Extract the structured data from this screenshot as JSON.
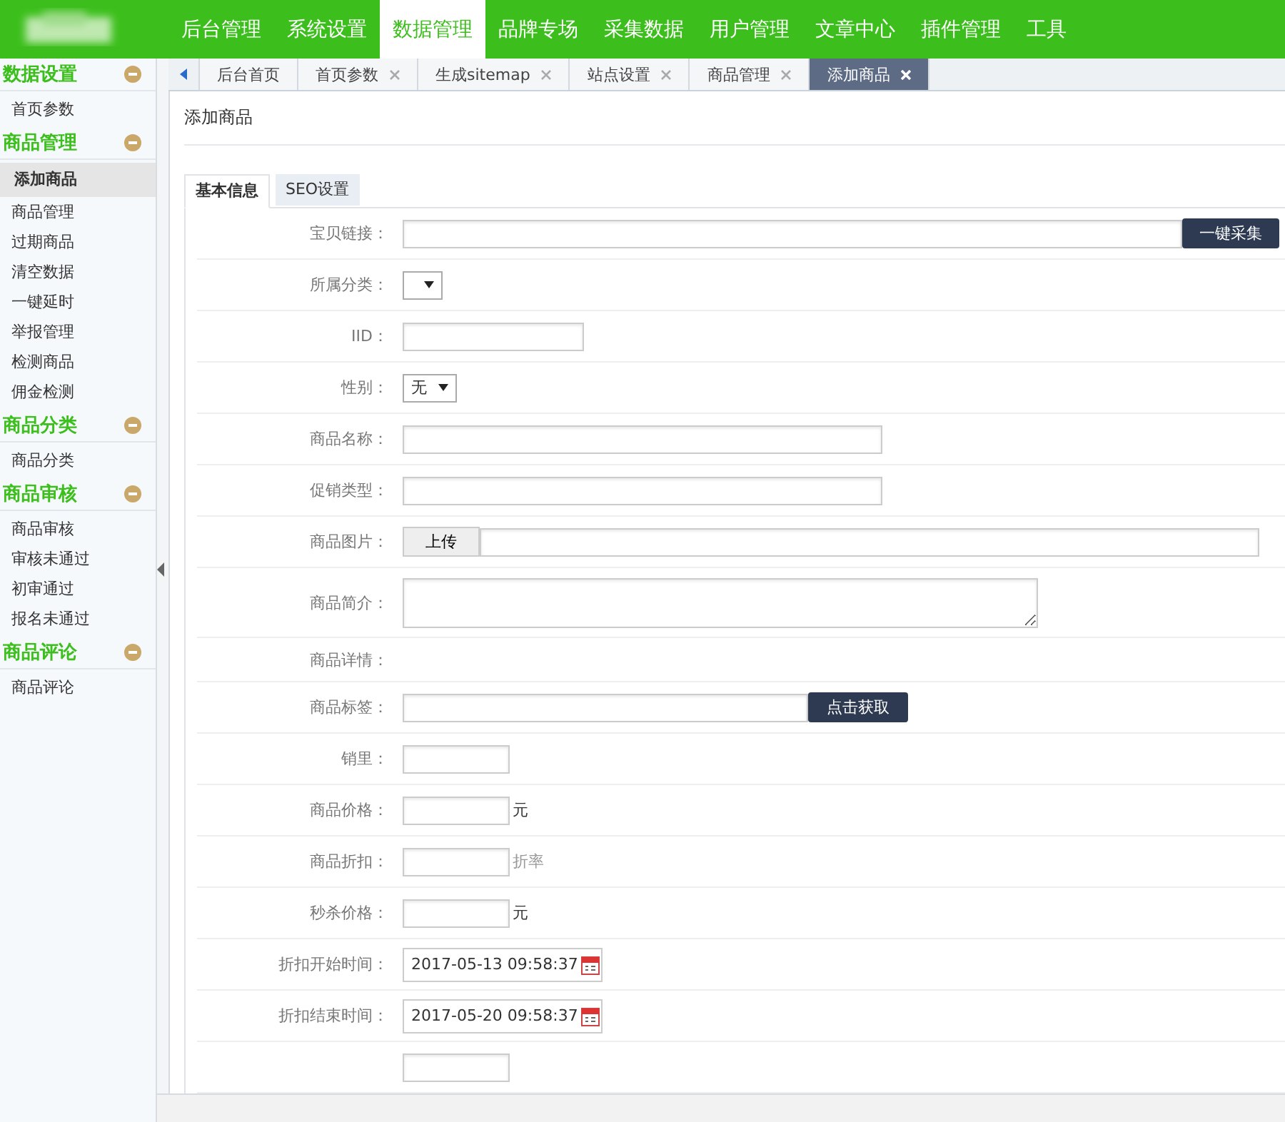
{
  "top_nav": [
    {
      "label": "后台管理",
      "selected": false
    },
    {
      "label": "系统设置",
      "selected": false
    },
    {
      "label": "数据管理",
      "selected": true
    },
    {
      "label": "品牌专场",
      "selected": false
    },
    {
      "label": "采集数据",
      "selected": false
    },
    {
      "label": "用户管理",
      "selected": false
    },
    {
      "label": "文章中心",
      "selected": false
    },
    {
      "label": "插件管理",
      "selected": false
    },
    {
      "label": "工具",
      "selected": false
    }
  ],
  "sidebar": {
    "groups": [
      {
        "title": "数据设置",
        "expanded": true,
        "items": [
          {
            "label": "首页参数",
            "selected": false
          }
        ]
      },
      {
        "title": "商品管理",
        "expanded": true,
        "items": [
          {
            "label": "添加商品",
            "selected": true
          },
          {
            "label": "商品管理",
            "selected": false
          },
          {
            "label": "过期商品",
            "selected": false
          },
          {
            "label": "清空数据",
            "selected": false
          },
          {
            "label": "一键延时",
            "selected": false
          },
          {
            "label": "举报管理",
            "selected": false
          },
          {
            "label": "检测商品",
            "selected": false
          },
          {
            "label": "佣金检测",
            "selected": false
          }
        ]
      },
      {
        "title": "商品分类",
        "expanded": true,
        "items": [
          {
            "label": "商品分类",
            "selected": false
          }
        ]
      },
      {
        "title": "商品审核",
        "expanded": true,
        "items": [
          {
            "label": "商品审核",
            "selected": false
          },
          {
            "label": "审核未通过",
            "selected": false
          },
          {
            "label": "初审通过",
            "selected": false
          },
          {
            "label": "报名未通过",
            "selected": false
          }
        ]
      },
      {
        "title": "商品评论",
        "expanded": true,
        "items": [
          {
            "label": "商品评论",
            "selected": false
          }
        ]
      }
    ]
  },
  "tabs": [
    {
      "label": "后台首页",
      "closable": false,
      "selected": false
    },
    {
      "label": "首页参数",
      "closable": true,
      "selected": false
    },
    {
      "label": "生成sitemap",
      "closable": true,
      "selected": false
    },
    {
      "label": "站点设置",
      "closable": true,
      "selected": false
    },
    {
      "label": "商品管理",
      "closable": true,
      "selected": false
    },
    {
      "label": "添加商品",
      "closable": true,
      "selected": true
    }
  ],
  "page_title": "添加商品",
  "form_tabs": [
    {
      "label": "基本信息",
      "selected": true
    },
    {
      "label": "SEO设置",
      "selected": false
    }
  ],
  "form_rows": [
    {
      "label": "宝贝链接：",
      "kind": "url",
      "button": "一键采集"
    },
    {
      "label": "所属分类：",
      "kind": "select"
    },
    {
      "label": "IID：",
      "kind": "short"
    },
    {
      "label": "性别：",
      "kind": "select",
      "value": "无"
    },
    {
      "label": "商品名称：",
      "kind": "text"
    },
    {
      "label": "促销类型：",
      "kind": "text"
    },
    {
      "label": "商品图片：",
      "kind": "upload",
      "button": "上传"
    },
    {
      "label": "商品简介：",
      "kind": "textarea"
    },
    {
      "label": "商品详情：",
      "kind": "none"
    },
    {
      "label": "商品标签：",
      "kind": "tags",
      "button": "点击获取"
    },
    {
      "label": "销里：",
      "kind": "small"
    },
    {
      "label": "商品价格：",
      "kind": "small",
      "unit": "元",
      "unit_muted": false
    },
    {
      "label": "商品折扣：",
      "kind": "small",
      "unit": "折率",
      "unit_muted": true
    },
    {
      "label": "秒杀价格：",
      "kind": "small",
      "unit": "元",
      "unit_muted": false
    },
    {
      "label": "折扣开始时间：",
      "kind": "date",
      "value": "2017-05-13 09:58:37"
    },
    {
      "label": "折扣结束时间：",
      "kind": "date",
      "value": "2017-05-20 09:58:37"
    },
    {
      "kind": "small"
    }
  ]
}
